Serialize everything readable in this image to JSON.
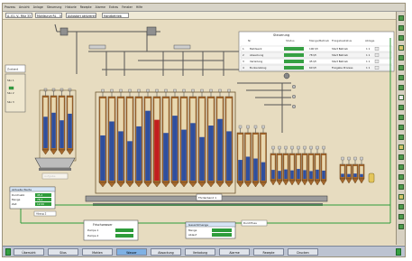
{
  "menubar": {
    "items": [
      "Prozess",
      "Ansicht",
      "Anlage",
      "Steuerung",
      "Historie",
      "Rezepte",
      "Alarme",
      "Extras",
      "Fenster",
      "Hilfe"
    ]
  },
  "toolbar": {
    "fields": [
      "A..01..V.. Ritz 33",
      "Mahlkurve RL - 001",
      "Autostart aktivieren",
      "Handbetrieb"
    ]
  },
  "status_table": {
    "title": "Steuerung",
    "headers": [
      "Nr",
      "Status",
      "Menge/Betrieb",
      "Freigabestatus",
      "Ablage"
    ],
    "rows": [
      {
        "nr": "1",
        "name": "Mahlwerk",
        "value": "100 t/h",
        "status": "Start Betrieb",
        "ablage": "1 1"
      },
      {
        "nr": "2",
        "name": "Absackung",
        "value": "78 t/h",
        "status": "Start Betrieb",
        "ablage": "1 1"
      },
      {
        "nr": "3",
        "name": "Verladung",
        "value": "45 t/h",
        "status": "Start Betrieb",
        "ablage": "1 1"
      },
      {
        "nr": "4",
        "name": "Bunkerabzug",
        "value": "60 t/h",
        "status": "Freigabe Prozess",
        "ablage": "1 1"
      }
    ]
  },
  "panels": {
    "left_info": {
      "title": "Zustand",
      "lines": [
        "Silo 1",
        "Silo 2",
        "Silo 3"
      ]
    },
    "left_values": {
      "title": "Aktuelle Werte",
      "rows": [
        "Durchsatz",
        "Menge",
        "Zeit"
      ],
      "values": [
        "45,2",
        "78,1",
        "12:00"
      ]
    },
    "conveyor_label": "Förderband 1",
    "bottom_center": {
      "title": "Frischwasser",
      "rows": [
        "Pumpe 1",
        "Pumpe 2"
      ]
    },
    "bottom_right": {
      "title": "Gesamtmenge",
      "rows": [
        "Menge",
        "Ablauf"
      ]
    },
    "bottom_right_small": "Durchfluss",
    "hopper_label": "Aufgabe",
    "left_small_label": "Abzug 2"
  },
  "silo_levels": {
    "group_a": [
      0.62,
      0.7,
      0.55,
      0.68
    ],
    "group_b": [
      0.55,
      0.72,
      0.6,
      0.48,
      0.66,
      0.85,
      0.74,
      0.58,
      0.79,
      0.62,
      0.7,
      0.53,
      0.67,
      0.75,
      0.6
    ],
    "group_c": [
      0.45,
      0.52,
      0.48,
      0.4
    ],
    "group_d": [
      0.38,
      0.34,
      0.4,
      0.36,
      0.42,
      0.37,
      0.33,
      0.39,
      0.35
    ],
    "group_e": [
      0.3,
      0.28,
      0.32,
      0.27
    ]
  },
  "highlight_silo_index": 6,
  "colors": {
    "background": "#e7dcc0",
    "silo_fill": "#2f4f9e",
    "silo_shell": "#a5692e",
    "highlight": "#c21e1e",
    "status_ok": "#36a043",
    "pipe": "#4a4a4a"
  },
  "taskbar": {
    "items": [
      "Übersicht",
      "Silos",
      "Mahlen",
      "Wasser",
      "Absackung",
      "Verladung",
      "Alarme",
      "Rezepte",
      "Drucken"
    ],
    "active": 3
  }
}
